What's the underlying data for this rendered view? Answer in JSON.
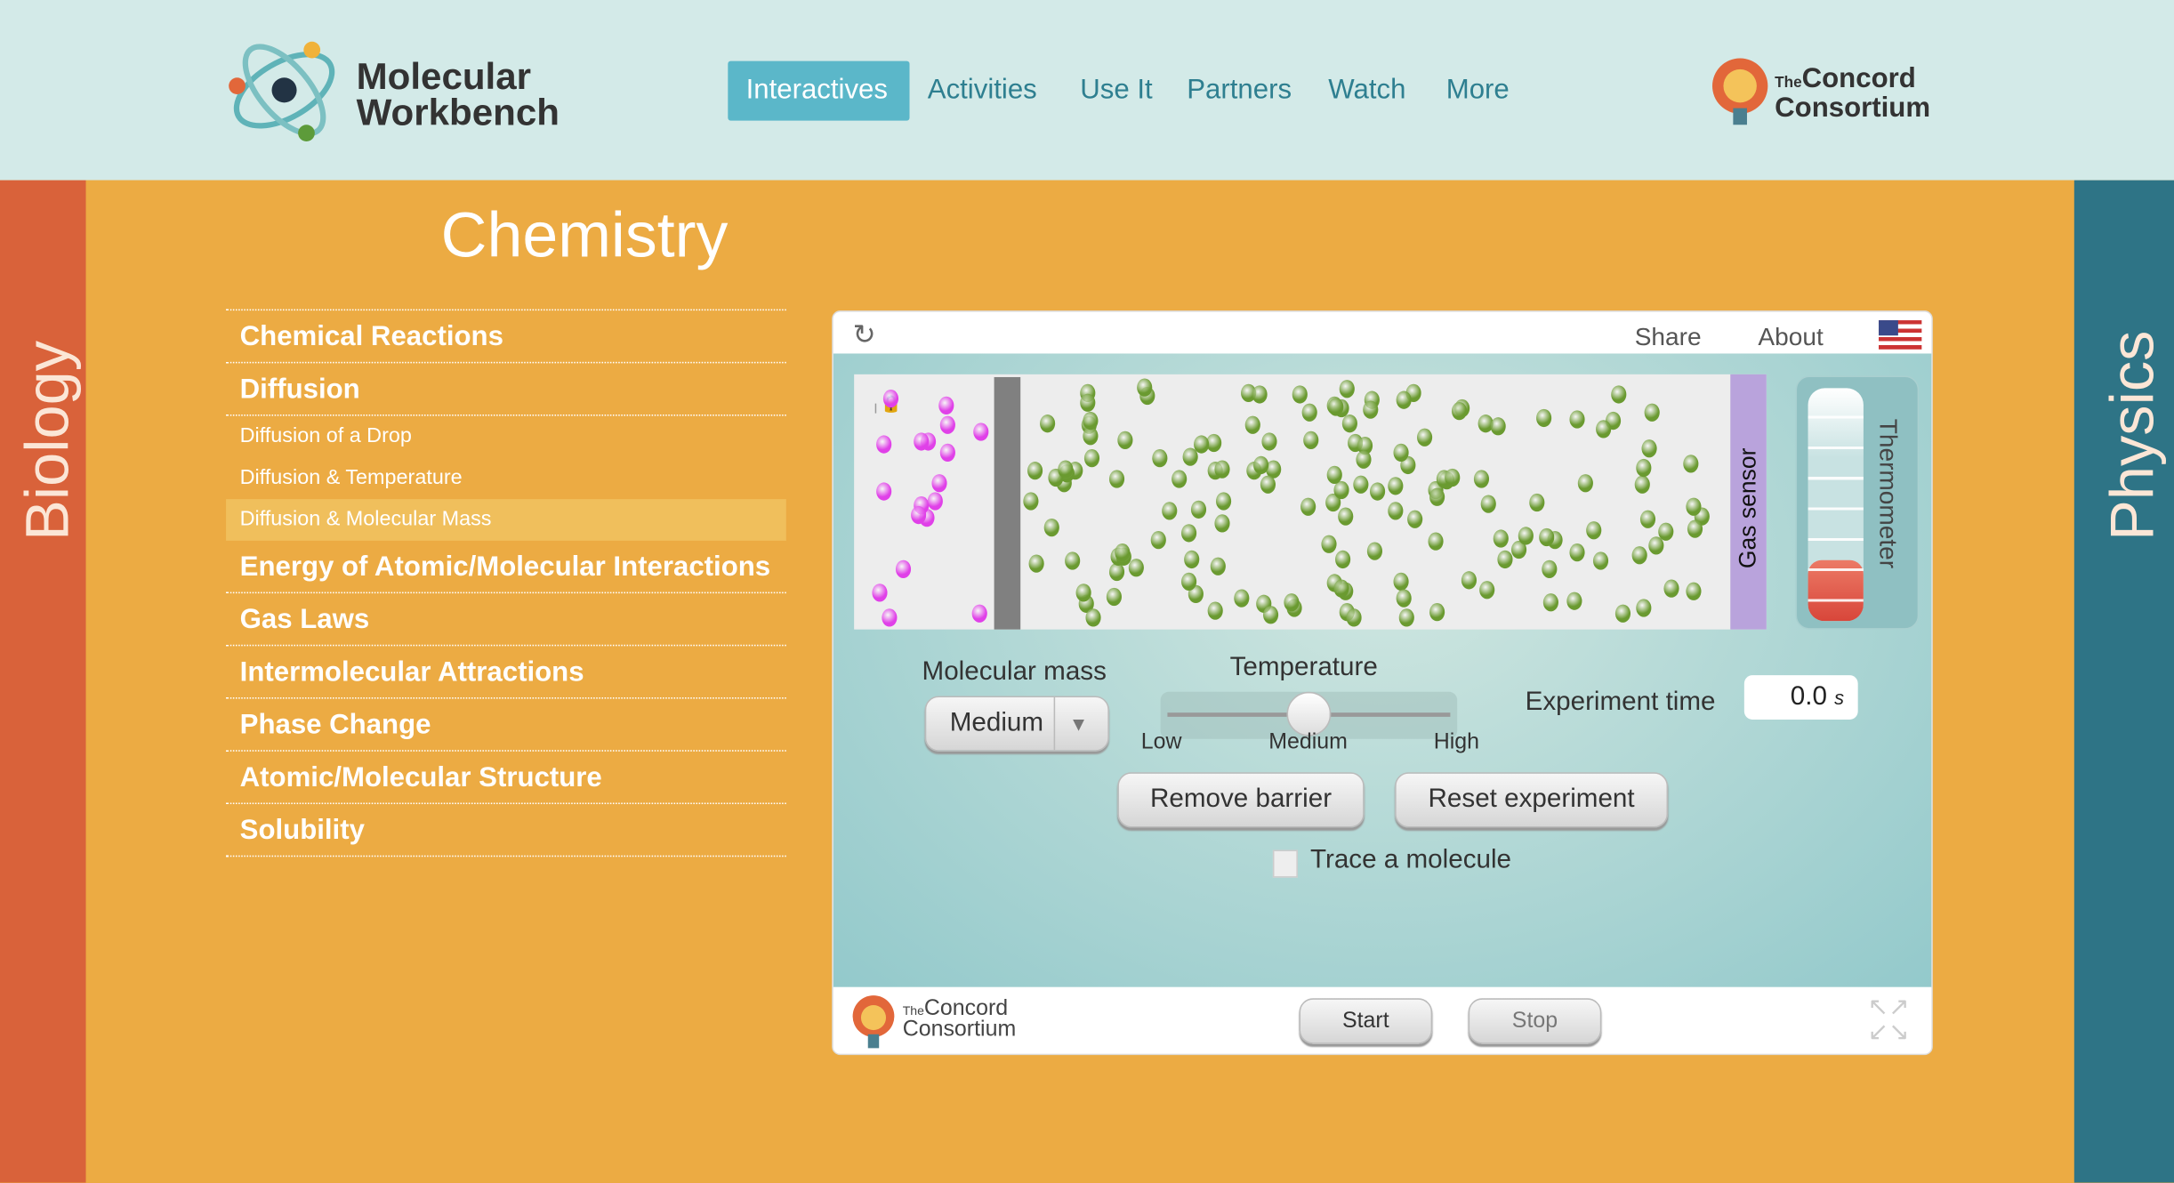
{
  "header": {
    "logo_line1": "Molecular",
    "logo_line2": "Workbench",
    "nav": [
      {
        "label": "Interactives",
        "active": true
      },
      {
        "label": "Activities"
      },
      {
        "label": "Use It"
      },
      {
        "label": "Partners"
      },
      {
        "label": "Watch"
      },
      {
        "label": "More"
      }
    ],
    "partner_logo": {
      "the": "The",
      "line1": "Concord",
      "line2": "Consortium"
    }
  },
  "side_left": "Biology",
  "side_right": "Physics",
  "page_title": "Chemistry",
  "menu": [
    {
      "label": "Chemical Reactions",
      "type": "main"
    },
    {
      "label": "Diffusion",
      "type": "main"
    },
    {
      "label": "Diffusion of a Drop",
      "type": "sub"
    },
    {
      "label": "Diffusion & Temperature",
      "type": "sub"
    },
    {
      "label": "Diffusion & Molecular Mass",
      "type": "sub",
      "selected": true
    },
    {
      "label": "Energy of Atomic/Molecular Interactions",
      "type": "main"
    },
    {
      "label": "Gas Laws",
      "type": "main"
    },
    {
      "label": "Intermolecular Attractions",
      "type": "main"
    },
    {
      "label": "Phase Change",
      "type": "main"
    },
    {
      "label": "Atomic/Molecular Structure",
      "type": "main"
    },
    {
      "label": "Solubility",
      "type": "main"
    }
  ],
  "sim": {
    "share": "Share",
    "about": "About",
    "reload_icon": "reload-icon",
    "flag_icon": "us-flag-icon",
    "gas_sensor": "Gas sensor",
    "thermometer": "Thermometer",
    "thermometer_level": 0.2,
    "molecular_mass_label": "Molecular mass",
    "molecular_mass_value": "Medium",
    "temperature_label": "Temperature",
    "temperature_ticks": [
      "Low",
      "Medium",
      "High"
    ],
    "temperature_value": 0.5,
    "experiment_time_label": "Experiment time",
    "experiment_time_value": "0.0",
    "experiment_time_unit": "s",
    "remove_barrier": "Remove barrier",
    "reset_experiment": "Reset experiment",
    "trace_label": "Trace a molecule",
    "trace_checked": false,
    "start": "Start",
    "stop": "Stop",
    "colors": {
      "purple_molecule": "#e040e8",
      "green_molecule": "#6a9a30",
      "barrier": "#808080",
      "gas_sensor": "#b9a3dc"
    }
  }
}
